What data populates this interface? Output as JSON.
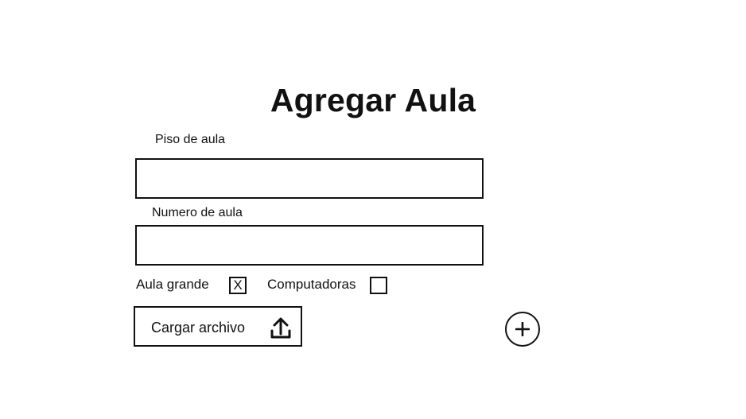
{
  "form": {
    "title": "Agregar Aula",
    "piso": {
      "label": "Piso de aula",
      "value": "",
      "placeholder": ""
    },
    "numero": {
      "label": "Numero de aula",
      "value": "",
      "placeholder": ""
    },
    "aula_grande": {
      "label": "Aula grande",
      "checked": true,
      "mark": "X"
    },
    "computadoras": {
      "label": "Computadoras",
      "checked": false,
      "mark": ""
    },
    "upload": {
      "label": "Cargar archivo",
      "icon": "upload-icon"
    },
    "add": {
      "icon": "plus-icon"
    }
  }
}
